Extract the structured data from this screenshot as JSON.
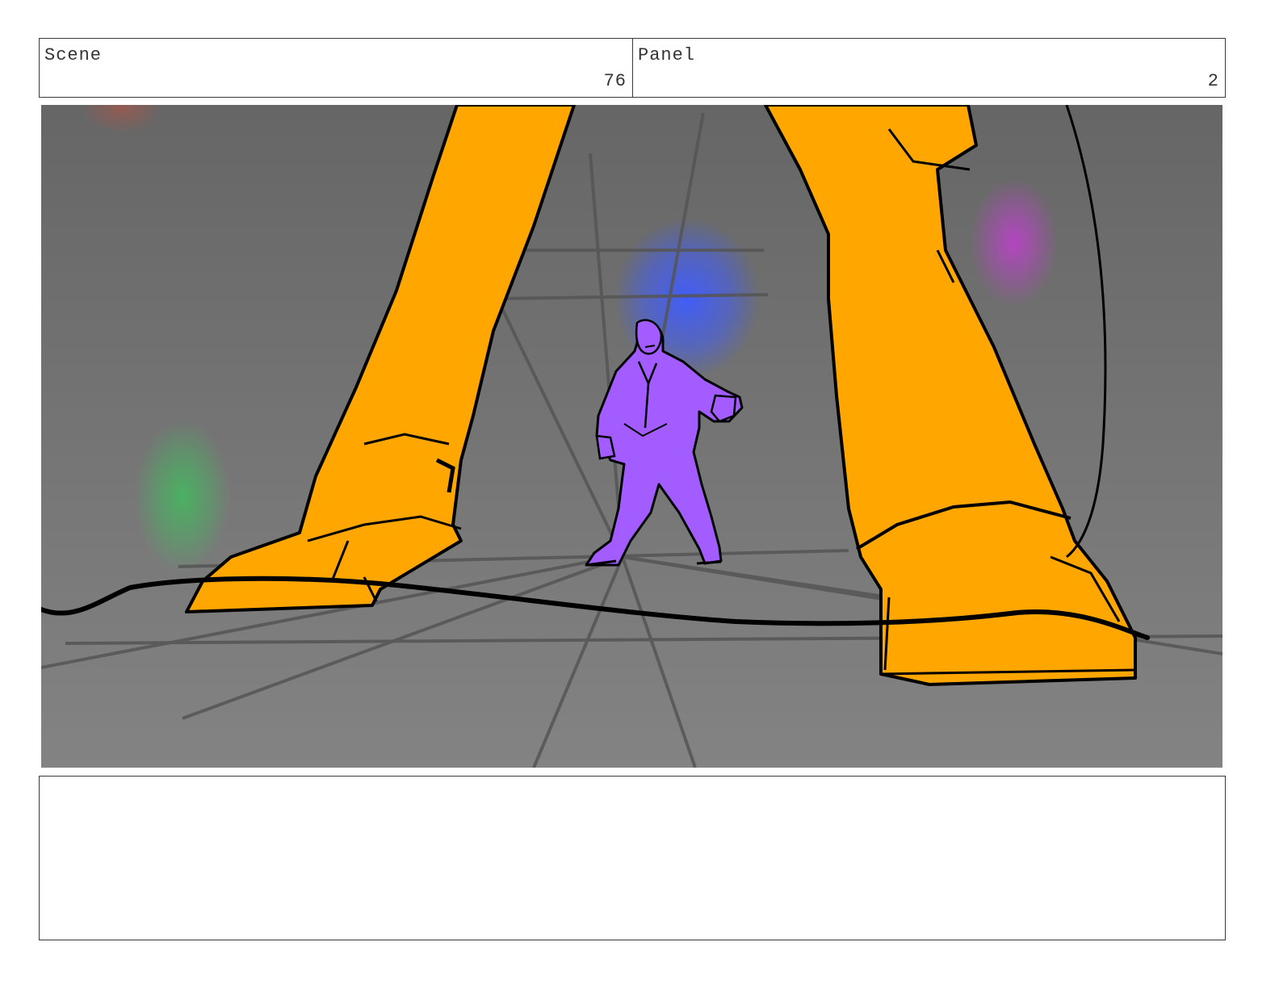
{
  "header": {
    "scene_label": "Scene",
    "scene_number": "76",
    "panel_label": "Panel",
    "panel_number": "2"
  },
  "notes": {
    "text": ""
  },
  "colors": {
    "floor": "#7a7a7a",
    "giant_legs": "#ffa600",
    "character": "#a35cff",
    "light_blue": "#3f5cff",
    "light_green": "#3fbf5c",
    "light_magenta": "#c03fcf",
    "ink": "#000000"
  }
}
